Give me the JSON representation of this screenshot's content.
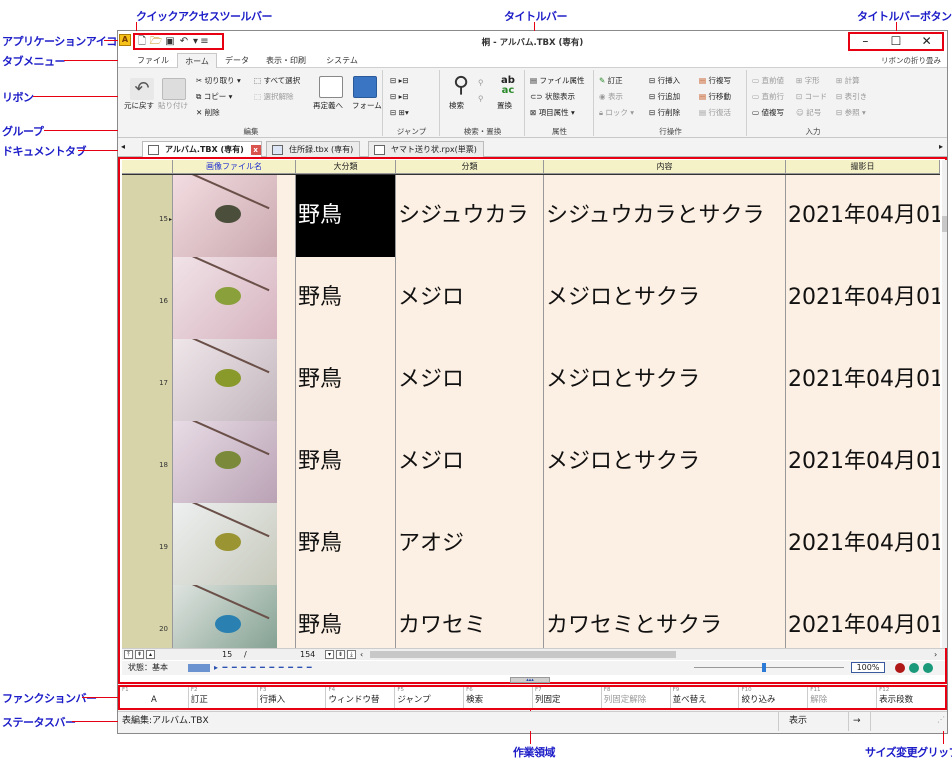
{
  "callouts": {
    "qat": "クイックアクセスツールバー",
    "titlebar": "タイトルバー",
    "titlebar_buttons": "タイトルバーボタン",
    "app_icon": "アプリケーションアイコン",
    "tab_menu": "タブメニュー",
    "ribbon": "リボン",
    "group": "グループ",
    "document_tab": "ドキュメントタブ",
    "function_bar": "ファンクションバー",
    "status_bar": "ステータスバー",
    "work_area": "作業領域",
    "size_grip": "サイズ変更グリップ"
  },
  "window": {
    "title": "桐 - アルバム.TBX (専有)",
    "minimize": "–",
    "maximize": "☐",
    "close": "✕"
  },
  "qat_icons": [
    "new-file-icon",
    "open-folder-icon",
    "save-icon",
    "undo-icon",
    "dropdown-icon",
    "customize-icon"
  ],
  "menu_tabs": [
    "ファイル",
    "ホーム",
    "データ",
    "表示・印刷",
    "システム"
  ],
  "active_tab": "ホーム",
  "ribbon_collapse": "リボンの折り畳み",
  "ribbon": {
    "groups": {
      "edit": "編集",
      "jump": "ジャンプ",
      "search_replace": "検索・置換",
      "attribute": "属性",
      "row_ops": "行操作",
      "input": "入力"
    },
    "edit": {
      "undo": "元に戻す",
      "paste": "貼り付け",
      "cut": "切り取り",
      "copy": "コピー",
      "delete": "削除",
      "select_all": "すべて選択",
      "deselect": "選択解除",
      "redefine": "再定義へ",
      "form": "フォーム"
    },
    "search": {
      "search": "検索",
      "replace": "置換"
    },
    "attr": {
      "file_attr": "ファイル属性",
      "status_view": "状態表示",
      "item_attr": "項目属性"
    },
    "row": {
      "correct": "訂正",
      "display": "表示",
      "lock": "ロック",
      "insert": "行挿入",
      "append": "行追加",
      "delete": "行削除",
      "copy": "行複写",
      "move": "行移動",
      "restore": "行復活"
    },
    "input": {
      "prev_value": "直前値",
      "char_shape": "字形",
      "calc": "計算",
      "prev_row": "直前行",
      "code": "コード",
      "table_ref": "表引き",
      "value_copy": "値複写",
      "symbol": "記号",
      "reference": "参照"
    }
  },
  "doc_tabs": [
    {
      "label": "アルバム.TBX (専有)",
      "active": true
    },
    {
      "label": "住所録.tbx (専有)",
      "active": false
    },
    {
      "label": "ヤマト送り状.rpx(単票)",
      "active": false
    }
  ],
  "grid": {
    "columns": [
      "画像ファイル名",
      "大分類",
      "分類",
      "内容",
      "撮影日"
    ],
    "rows": [
      {
        "num": "15",
        "big": "野鳥",
        "cat": "シジュウカラ",
        "content": "シジュウカラとサクラ",
        "date": "2021年04月01",
        "current": true
      },
      {
        "num": "16",
        "big": "野鳥",
        "cat": "メジロ",
        "content": "メジロとサクラ",
        "date": "2021年04月01",
        "current": false
      },
      {
        "num": "17",
        "big": "野鳥",
        "cat": "メジロ",
        "content": "メジロとサクラ",
        "date": "2021年04月01",
        "current": false
      },
      {
        "num": "18",
        "big": "野鳥",
        "cat": "メジロ",
        "content": "メジロとサクラ",
        "date": "2021年04月01",
        "current": false
      },
      {
        "num": "19",
        "big": "野鳥",
        "cat": "アオジ",
        "content": "",
        "date": "2021年04月01",
        "current": false
      },
      {
        "num": "20",
        "big": "野鳥",
        "cat": "カワセミ",
        "content": "カワセミとサクラ",
        "date": "2021年04月01",
        "current": false
      }
    ]
  },
  "nav": {
    "current": "15",
    "sep": "/",
    "total": "154"
  },
  "status": {
    "label": "状態：基本",
    "zoom": "100%"
  },
  "function_keys": [
    {
      "key": "F1",
      "label": "A",
      "disabled": false
    },
    {
      "key": "F2",
      "label": "訂正",
      "disabled": false
    },
    {
      "key": "F3",
      "label": "行挿入",
      "disabled": false
    },
    {
      "key": "F4",
      "label": "ウィンドウ替",
      "disabled": false
    },
    {
      "key": "F5",
      "label": "ジャンプ",
      "disabled": false
    },
    {
      "key": "F6",
      "label": "検索",
      "disabled": false
    },
    {
      "key": "F7",
      "label": "列固定",
      "disabled": false
    },
    {
      "key": "F8",
      "label": "列固定解除",
      "disabled": true
    },
    {
      "key": "F9",
      "label": "並べ替え",
      "disabled": false
    },
    {
      "key": "F10",
      "label": "絞り込み",
      "disabled": false
    },
    {
      "key": "F11",
      "label": "解除",
      "disabled": true
    },
    {
      "key": "F12",
      "label": "表示段数",
      "disabled": false
    }
  ],
  "statusbar": {
    "mode": "表編集:アルバム.TBX",
    "view": "表示",
    "arrow": "→"
  },
  "colors": {
    "callout_text": "#1c1cc8",
    "callout_line": "#e60012",
    "cell_bg": "#fcefe3",
    "row_header": "#d6d4a8",
    "header_bg": "#f5f2c8"
  }
}
